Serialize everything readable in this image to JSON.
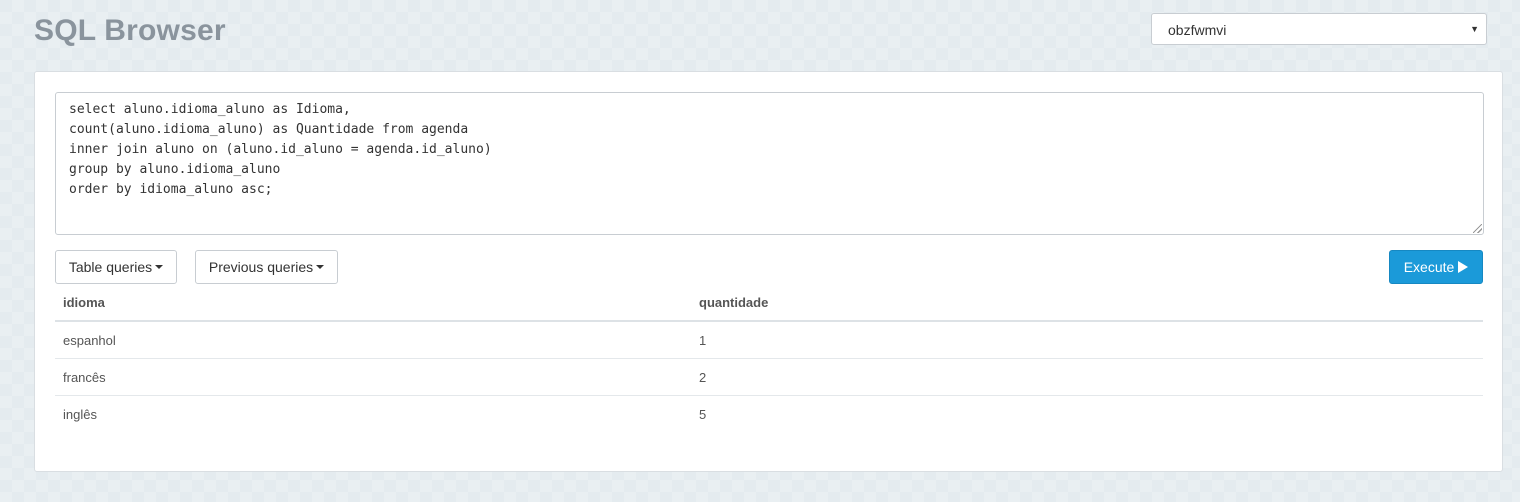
{
  "app": {
    "title": "SQL Browser"
  },
  "database_select": {
    "selected": "obzfwmvi",
    "caret": "▼"
  },
  "editor": {
    "lines": [
      "select aluno.idioma_aluno as Idioma,",
      "count(aluno.idioma_aluno) as Quantidade from agenda",
      "inner join aluno on (aluno.id_aluno = agenda.id_aluno)",
      "group by aluno.idioma_aluno",
      "order by idioma_aluno asc;"
    ]
  },
  "toolbar": {
    "table_queries_label": "Table queries",
    "previous_queries_label": "Previous queries",
    "execute_label": "Execute"
  },
  "results": {
    "headers": [
      "idioma",
      "quantidade"
    ],
    "rows": [
      [
        "espanhol",
        "1"
      ],
      [
        "francês",
        "2"
      ],
      [
        "inglês",
        "5"
      ]
    ]
  },
  "colors": {
    "accent": "#1b9ad9",
    "title": "#8a949d",
    "background": "#e4ebef"
  }
}
